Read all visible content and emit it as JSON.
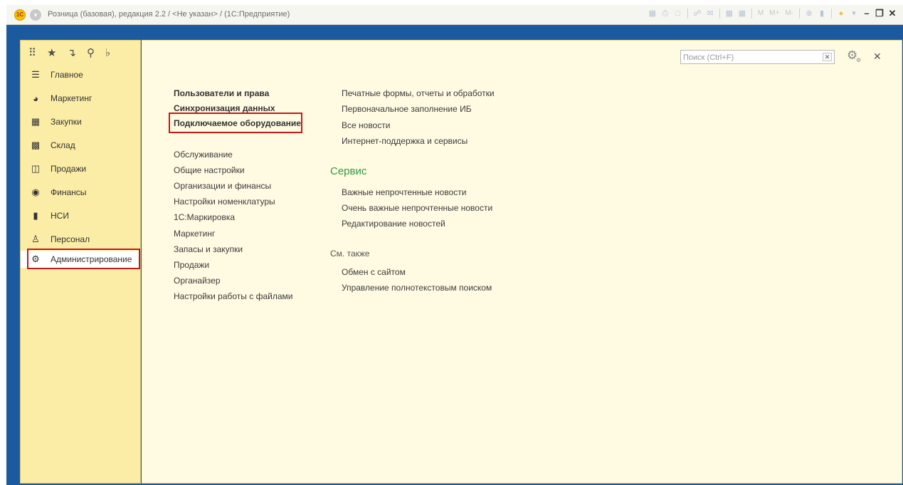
{
  "titlebar": {
    "logo_text": "1С",
    "title": "Розница (базовая), редакция 2.2 / <Не указан> / (1С:Предприятие)",
    "memory_labels": [
      "M",
      "M+",
      "M-"
    ]
  },
  "sidebar": {
    "tools": [
      "apps-grid-icon",
      "star-icon",
      "history-icon",
      "search-icon",
      "bell-icon"
    ],
    "items": [
      {
        "label": "Главное",
        "icon": "menu-lines-icon"
      },
      {
        "label": "Маркетинг",
        "icon": "pie-chart-icon"
      },
      {
        "label": "Закупки",
        "icon": "cart-icon"
      },
      {
        "label": "Склад",
        "icon": "warehouse-icon"
      },
      {
        "label": "Продажи",
        "icon": "basket-icon"
      },
      {
        "label": "Финансы",
        "icon": "ruble-coin-icon"
      },
      {
        "label": "НСИ",
        "icon": "books-icon"
      },
      {
        "label": "Персонал",
        "icon": "person-icon"
      },
      {
        "label": "Администрирование",
        "icon": "gear-icon"
      }
    ],
    "selected": "Администрирование"
  },
  "search": {
    "placeholder": "Поиск (Ctrl+F)",
    "value": ""
  },
  "main": {
    "col1_bold": [
      "Пользователи и права",
      "Синхронизация данных",
      "Подключаемое оборудование"
    ],
    "col1_links": [
      "Обслуживание",
      "Общие настройки",
      "Организации и финансы",
      "Настройки номенклатуры",
      "1С:Маркировка",
      "Маркетинг",
      "Запасы и закупки",
      "Продажи",
      "Органайзер",
      "Настройки работы с файлами"
    ],
    "col2_links": [
      "Печатные формы, отчеты и обработки",
      "Первоначальное заполнение ИБ",
      "Все новости",
      "Интернет-поддержка и сервисы"
    ],
    "service_title": "Сервис",
    "service_links": [
      "Важные непрочтенные новости",
      "Очень важные непрочтенные новости",
      "Редактирование новостей"
    ],
    "see_also_title": "См. также",
    "see_also_links": [
      "Обмен с сайтом",
      "Управление полнотекстовым поиском"
    ]
  },
  "colors": {
    "frame": "#1c5aa0",
    "sidebar_bg": "#fbeda6",
    "main_bg": "#fffbe2",
    "section_title": "#2e9a43",
    "highlight": "#c11a1a"
  }
}
